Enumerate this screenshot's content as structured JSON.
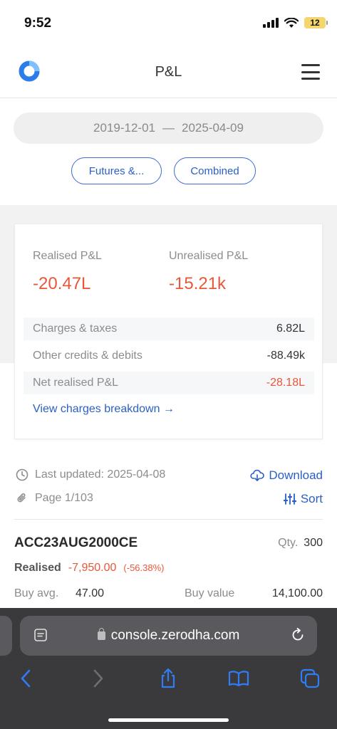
{
  "status_bar": {
    "time": "9:52",
    "battery": "12"
  },
  "header": {
    "title": "P&L"
  },
  "filters": {
    "date_from": "2019-12-01",
    "date_sep": "—",
    "date_to": "2025-04-09",
    "segment_label": "Futures &...",
    "combined_label": "Combined"
  },
  "summary": {
    "realised_label": "Realised P&L",
    "realised_value": "-20.47L",
    "unrealised_label": "Unrealised P&L",
    "unrealised_value": "-15.21k",
    "rows": [
      {
        "label": "Charges & taxes",
        "value": "6.82L"
      },
      {
        "label": "Other credits & debits",
        "value": "-88.49k"
      },
      {
        "label": "Net realised P&L",
        "value": "-28.18L"
      }
    ],
    "breakdown_link": "View charges breakdown →"
  },
  "meta": {
    "last_updated": "Last updated: 2025-04-08",
    "page": "Page 1/103",
    "download_label": "Download",
    "sort_label": "Sort"
  },
  "position": {
    "symbol": "ACC23AUG2000CE",
    "qty_label": "Qty.",
    "qty_value": "300",
    "realised_tag": "Realised",
    "realised_amount": "-7,950.00",
    "realised_pct": "(-56.38%)",
    "buy_avg_label": "Buy avg.",
    "buy_avg_value": "47.00",
    "buy_value_label": "Buy value",
    "buy_value_value": "14,100.00"
  },
  "browser": {
    "url": "console.zerodha.com"
  },
  "colors": {
    "accent": "#2a5fc7",
    "negative": "#e9573a",
    "logo": "#2b7de9"
  }
}
